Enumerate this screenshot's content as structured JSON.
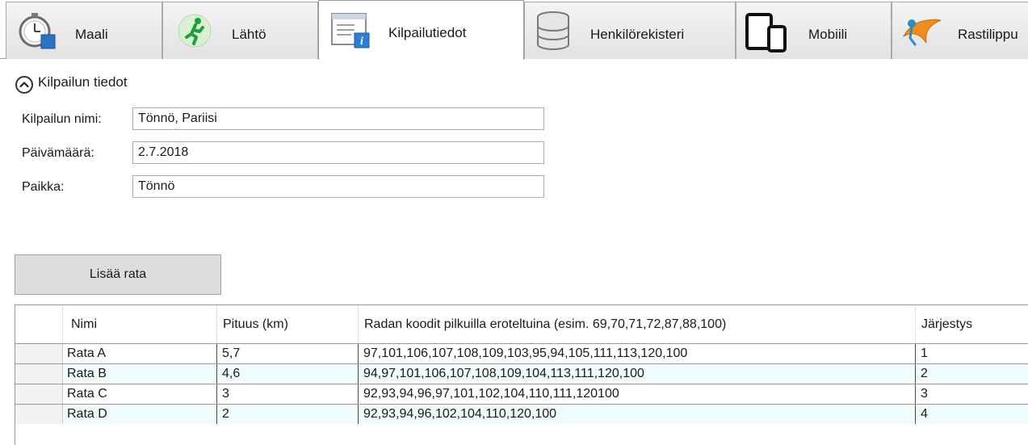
{
  "tabs": [
    {
      "label": "Maali",
      "icon": "stopwatch-icon",
      "active": false
    },
    {
      "label": "Lähtö",
      "icon": "running-man-icon",
      "active": false
    },
    {
      "label": "Kilpailutiedot",
      "icon": "info-document-icon",
      "active": true
    },
    {
      "label": "Henkilörekisteri",
      "icon": "database-icon",
      "active": false
    },
    {
      "label": "Mobiili",
      "icon": "mobile-devices-icon",
      "active": false
    },
    {
      "label": "Rastilippu",
      "icon": "orienteering-flag-icon",
      "active": false
    }
  ],
  "section": {
    "title": "Kilpailun tiedot"
  },
  "form": {
    "name_label": "Kilpailun nimi:",
    "name_value": "Tönnö, Pariisi",
    "date_label": "Päivämäärä:",
    "date_value": "2.7.2018",
    "place_label": "Paikka:",
    "place_value": "Tönnö"
  },
  "add_course_button": "Lisää rata",
  "grid": {
    "columns": [
      "Nimi",
      "Pituus (km)",
      "Radan koodit pilkuilla eroteltuina (esim. 69,70,71,72,87,88,100)",
      "Järjestys"
    ],
    "rows": [
      [
        "Rata A",
        "5,7",
        "97,101,106,107,108,109,103,95,94,105,111,113,120,100",
        "1"
      ],
      [
        "Rata B",
        "4,6",
        "94,97,101,106,107,108,109,104,113,111,120,100",
        "2"
      ],
      [
        "Rata C",
        "3",
        "92,93,94,96,97,101,102,104,110,111,120100",
        "3"
      ],
      [
        "Rata D",
        "2",
        "92,93,94,96,102,104,110,120,100",
        "4"
      ]
    ]
  },
  "colors": {
    "alt_row": "#f0fbfc",
    "button_bg": "#dddddd",
    "tab_bg": "#e8e8e8"
  }
}
